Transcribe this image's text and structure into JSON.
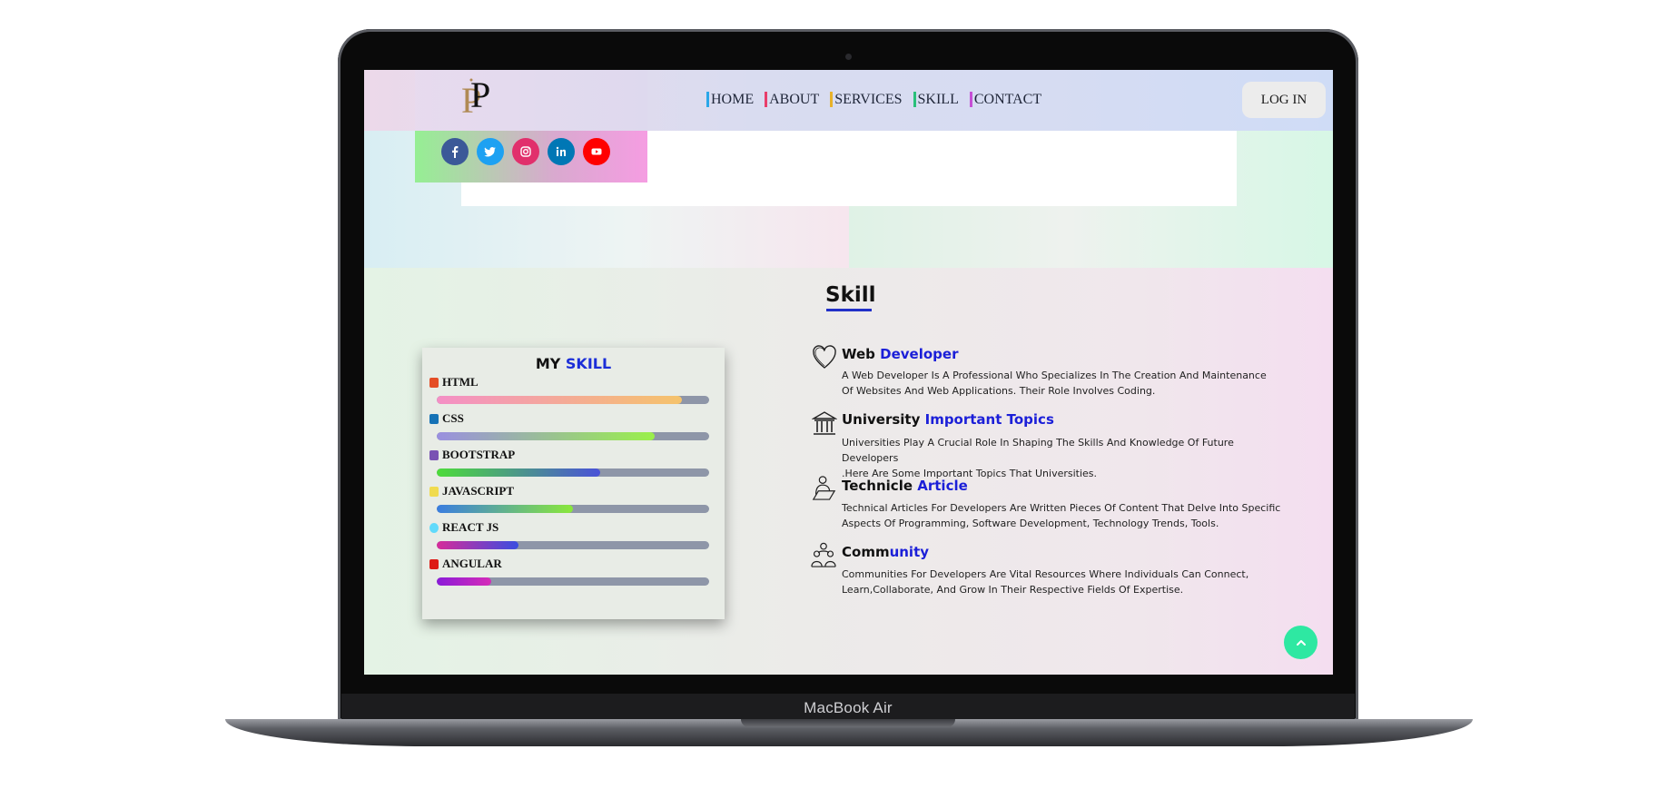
{
  "device": {
    "brand_label": "MacBook Air"
  },
  "navbar": {
    "logo_text": "P",
    "links": [
      {
        "label": "HOME",
        "accent": "#2aa7e8"
      },
      {
        "label": "ABOUT",
        "accent": "#e83e6b"
      },
      {
        "label": "SERVICES",
        "accent": "#e8b22a"
      },
      {
        "label": "SKILL",
        "accent": "#2ac07a"
      },
      {
        "label": "CONTACT",
        "accent": "#c64fd6"
      }
    ],
    "login_label": "LOG IN"
  },
  "social": [
    {
      "name": "facebook-icon",
      "color": "#3b5998"
    },
    {
      "name": "twitter-icon",
      "color": "#1da1f2"
    },
    {
      "name": "instagram-icon",
      "color": "#e1306c"
    },
    {
      "name": "linkedin-icon",
      "color": "#0077b5"
    },
    {
      "name": "youtube-icon",
      "color": "#ff0000"
    }
  ],
  "skill_section": {
    "heading": "Skill",
    "card": {
      "title_prefix": "MY",
      "title_accent": "SKILL",
      "skills": [
        {
          "label": "HTML",
          "icon_color": "#e44d26",
          "level": 0.9,
          "gradient": [
            "#f48fc6",
            "#f5c36b"
          ]
        },
        {
          "label": "CSS",
          "icon_color": "#1572b6",
          "level": 0.8,
          "gradient": [
            "#9a8fe0",
            "#9af04a"
          ]
        },
        {
          "label": "BOOTSTRAP",
          "icon_color": "#7952b3",
          "level": 0.6,
          "gradient": [
            "#4ddc3a",
            "#4a52d8"
          ]
        },
        {
          "label": "JAVASCRIPT",
          "icon_color": "#f0db4f",
          "level": 0.5,
          "gradient": [
            "#3a7de0",
            "#8ae83a"
          ]
        },
        {
          "label": "REACT JS",
          "icon_color": "#61dafb",
          "level": 0.3,
          "gradient": [
            "#d62c9a",
            "#3a4ee0"
          ]
        },
        {
          "label": "ANGULAR",
          "icon_color": "#dd1b16",
          "level": 0.2,
          "gradient": [
            "#8a1bd8",
            "#d62cb8"
          ]
        }
      ]
    },
    "topics": [
      {
        "icon": "heart-icon",
        "title_plain": "Web",
        "title_highlight": "Developer",
        "line1": "A Web Developer Is A Professional Who Specializes In The Creation And Maintenance",
        "line2": "Of Websites And Web Applications. Their Role Involves Coding."
      },
      {
        "icon": "university-icon",
        "title_plain": "University",
        "title_highlight": "Important Topics",
        "line1": "Universities Play A Crucial Role In Shaping The Skills And Knowledge Of Future Developers",
        "line2": ".Here Are Some Important Topics That Universities."
      },
      {
        "icon": "article-writer-icon",
        "title_plain": "Technicle",
        "title_highlight": "Article",
        "line1": "Technical Articles For Developers Are Written Pieces Of Content That Delve Into Specific",
        "line2": "Aspects Of Programming, Software Development, Technology Trends, Tools."
      },
      {
        "icon": "community-icon",
        "title_plain": "Comm",
        "title_highlight": "unity",
        "line1": "Communities For Developers Are Vital Resources Where Individuals Can Connect,",
        "line2": "Learn,Collaborate, And Grow In Their Respective Fields Of Expertise."
      }
    ]
  },
  "scroll_top": {
    "icon": "chevron-up-icon"
  }
}
